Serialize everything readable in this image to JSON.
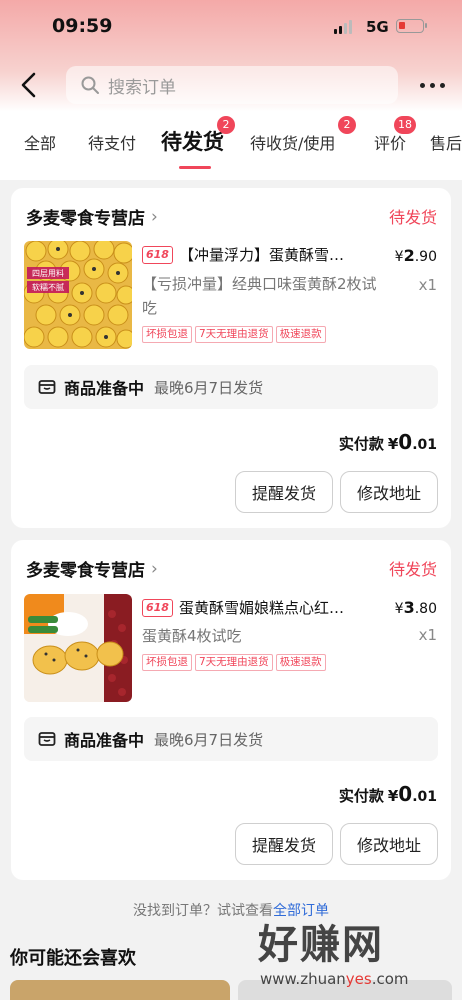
{
  "status_bar": {
    "time": "09:59",
    "network": "5G"
  },
  "navbar": {
    "search_placeholder": "搜索订单"
  },
  "tabs": [
    {
      "label": "全部",
      "badge": ""
    },
    {
      "label": "待支付",
      "badge": ""
    },
    {
      "label": "待发货",
      "badge": "2",
      "active": true
    },
    {
      "label": "待收货/使用",
      "badge": "2"
    },
    {
      "label": "评价",
      "badge": "18"
    },
    {
      "label": "售后",
      "badge": ""
    }
  ],
  "orders": [
    {
      "shop_name": "多麦零食专营店",
      "status": "待发货",
      "promo_tag": "618",
      "product_title": "【冲量浮力】蛋黄酥雪…",
      "price_yen": "¥",
      "price_int": "2",
      "price_dec": ".90",
      "spec": "【亏损冲量】经典口味蛋黄酥2枚试吃",
      "quantity": "x1",
      "services": [
        "坏损包退",
        "7天无理由退货",
        "极速退款"
      ],
      "thumb_text_1": "四层用料",
      "thumb_text_2": "软糯不腻",
      "prep_title": "商品准备中",
      "prep_eta": "最晚6月7日发货",
      "paid_label": "实付款",
      "paid_yen": "¥",
      "paid_int": "0",
      "paid_dec": ".01",
      "btn_remind": "提醒发货",
      "btn_address": "修改地址"
    },
    {
      "shop_name": "多麦零食专营店",
      "status": "待发货",
      "promo_tag": "618",
      "product_title": "蛋黄酥雪媚娘糕点心红…",
      "price_yen": "¥",
      "price_int": "3",
      "price_dec": ".80",
      "spec": "蛋黄酥4枚试吃",
      "quantity": "x1",
      "services": [
        "坏损包退",
        "7天无理由退货",
        "极速退款"
      ],
      "prep_title": "商品准备中",
      "prep_eta": "最晚6月7日发货",
      "paid_label": "实付款",
      "paid_yen": "¥",
      "paid_int": "0",
      "paid_dec": ".01",
      "btn_remind": "提醒发货",
      "btn_address": "修改地址"
    }
  ],
  "footer": {
    "not_found_text": "没找到订单？试试查看",
    "not_found_link": "全部订单",
    "recommend_title": "你可能还会喜欢"
  },
  "watermark": {
    "main": "好赚网",
    "sub_prefix": "www.zhuan",
    "sub_highlight": "yes",
    "sub_suffix": ".com"
  },
  "colors": {
    "accent": "#f0465a",
    "link": "#2f6bd8",
    "background": "#f2f2f2"
  }
}
